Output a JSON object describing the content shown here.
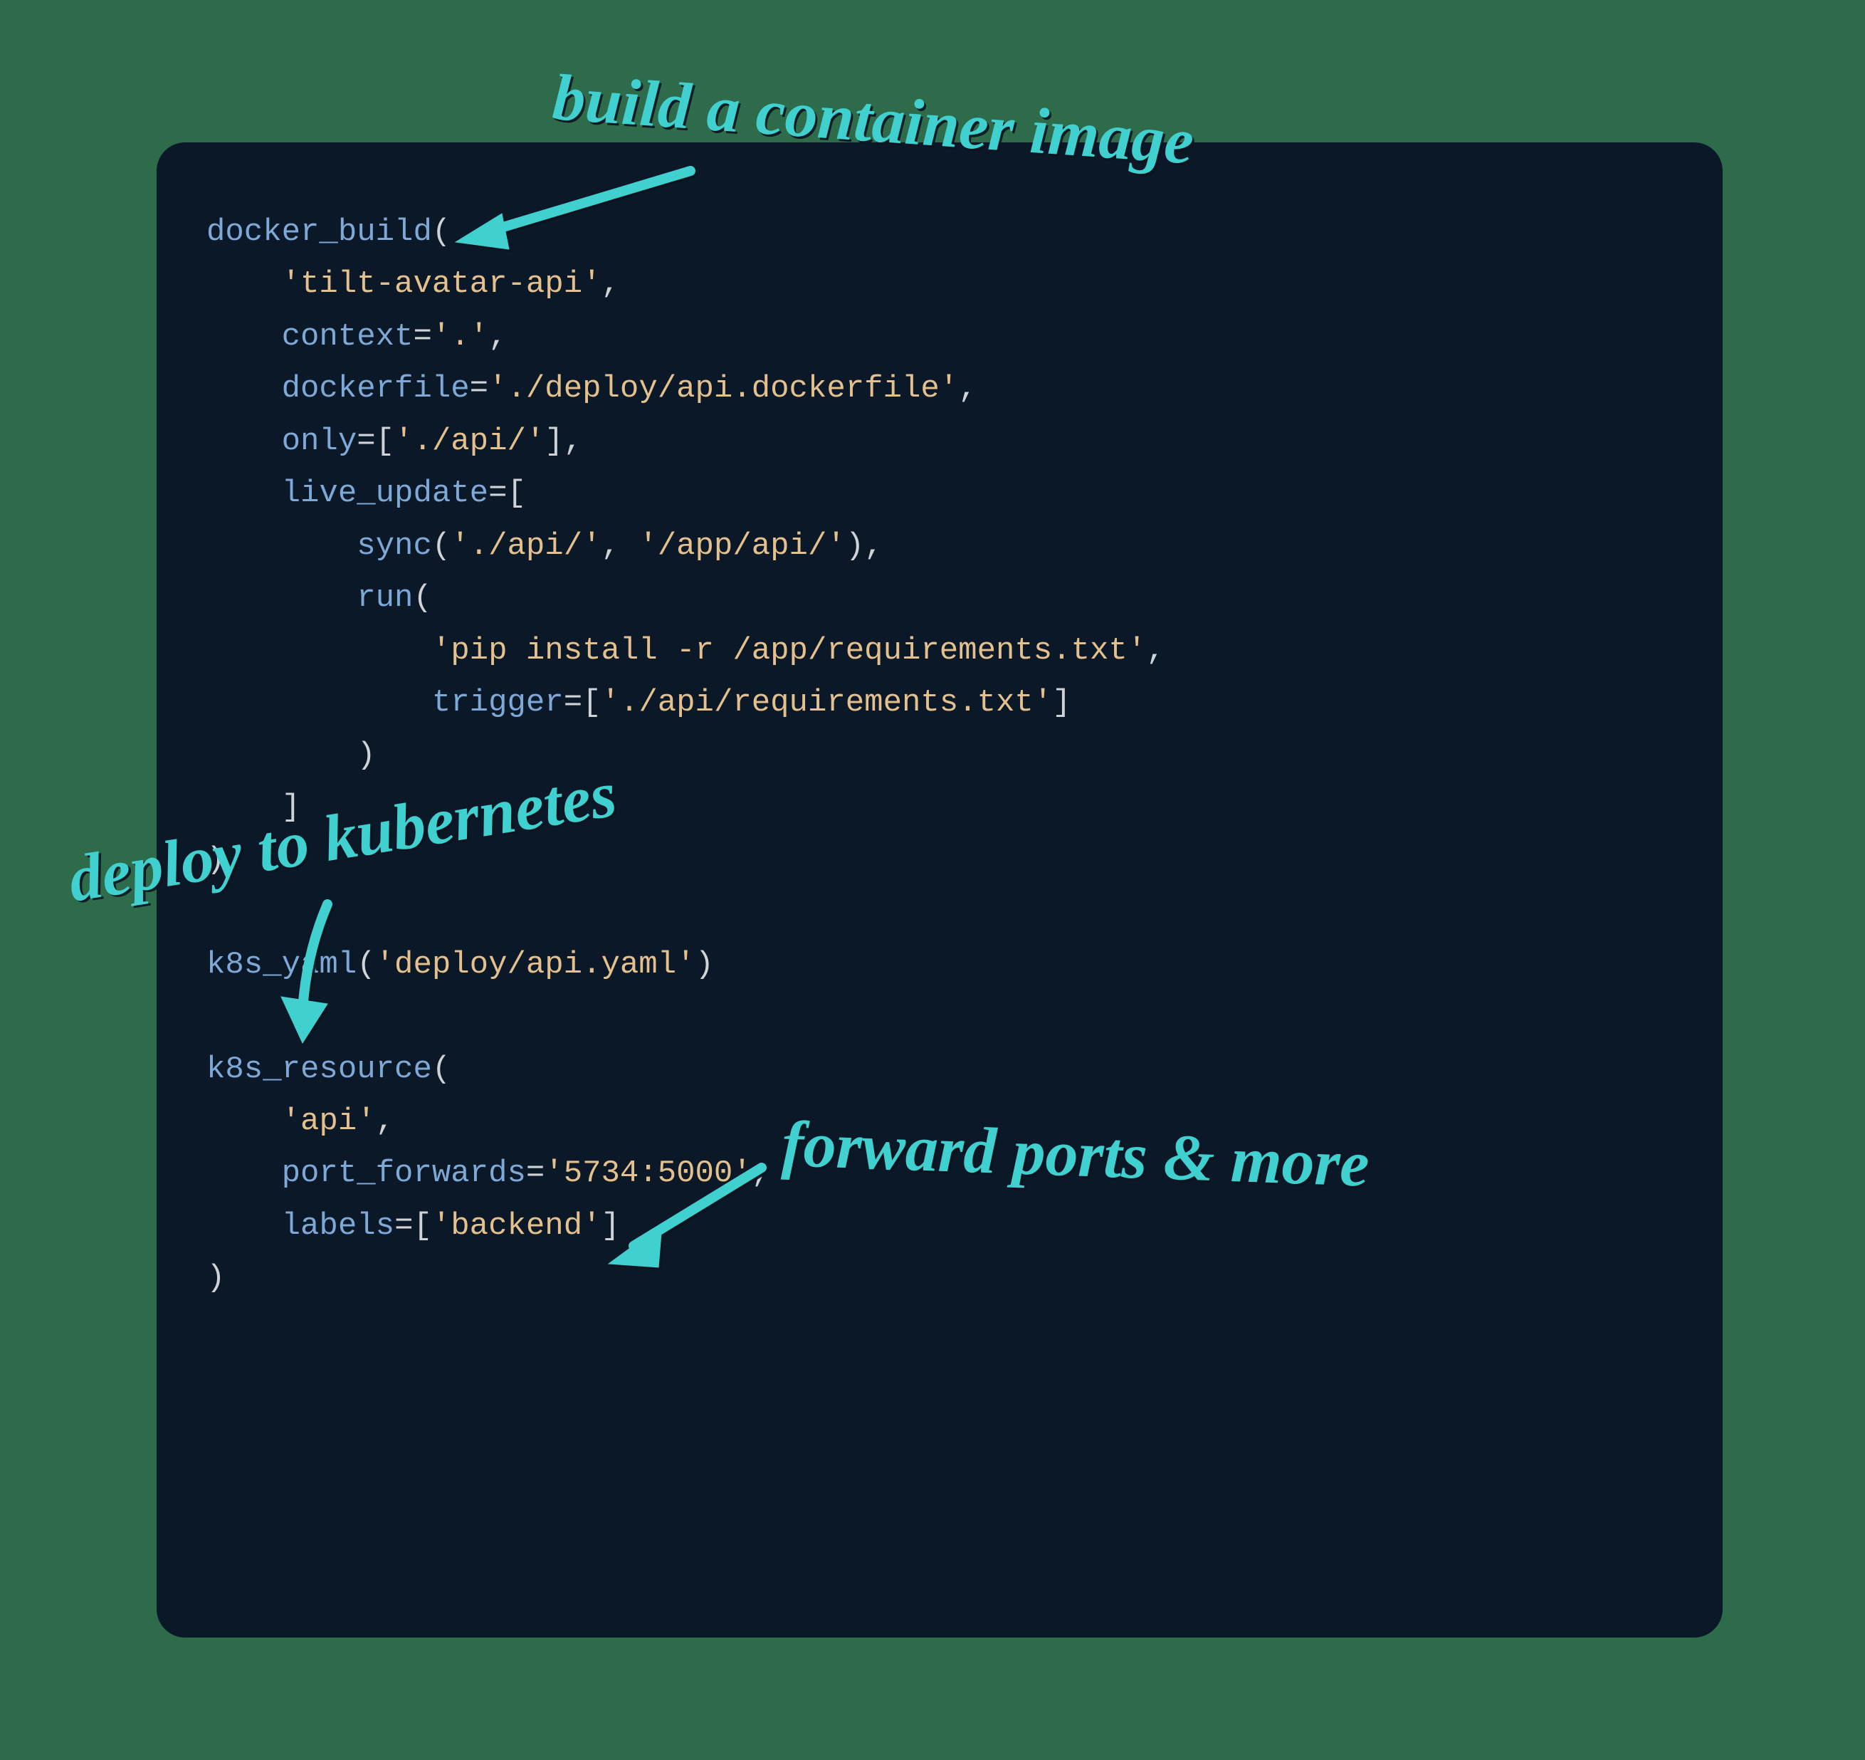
{
  "annotations": {
    "build": "build a container image",
    "deploy": "deploy to kubernetes",
    "forward": "forward ports & more"
  },
  "code": {
    "lines": [
      [
        {
          "cls": "fn",
          "t": "docker_build"
        },
        {
          "cls": "pun",
          "t": "("
        }
      ],
      [
        {
          "cls": "pun",
          "t": "    "
        },
        {
          "cls": "str",
          "t": "'tilt-avatar-api'"
        },
        {
          "cls": "pun",
          "t": ","
        }
      ],
      [
        {
          "cls": "pun",
          "t": "    "
        },
        {
          "cls": "kw",
          "t": "context"
        },
        {
          "cls": "pun",
          "t": "="
        },
        {
          "cls": "str",
          "t": "'.'"
        },
        {
          "cls": "pun",
          "t": ","
        }
      ],
      [
        {
          "cls": "pun",
          "t": "    "
        },
        {
          "cls": "kw",
          "t": "dockerfile"
        },
        {
          "cls": "pun",
          "t": "="
        },
        {
          "cls": "str",
          "t": "'./deploy/api.dockerfile'"
        },
        {
          "cls": "pun",
          "t": ","
        }
      ],
      [
        {
          "cls": "pun",
          "t": "    "
        },
        {
          "cls": "kw",
          "t": "only"
        },
        {
          "cls": "pun",
          "t": "=["
        },
        {
          "cls": "str",
          "t": "'./api/'"
        },
        {
          "cls": "pun",
          "t": "],"
        }
      ],
      [
        {
          "cls": "pun",
          "t": "    "
        },
        {
          "cls": "kw",
          "t": "live_update"
        },
        {
          "cls": "pun",
          "t": "=["
        }
      ],
      [
        {
          "cls": "pun",
          "t": "        "
        },
        {
          "cls": "fn",
          "t": "sync"
        },
        {
          "cls": "pun",
          "t": "("
        },
        {
          "cls": "str",
          "t": "'./api/'"
        },
        {
          "cls": "pun",
          "t": ", "
        },
        {
          "cls": "str",
          "t": "'/app/api/'"
        },
        {
          "cls": "pun",
          "t": "),"
        }
      ],
      [
        {
          "cls": "pun",
          "t": "        "
        },
        {
          "cls": "fn",
          "t": "run"
        },
        {
          "cls": "pun",
          "t": "("
        }
      ],
      [
        {
          "cls": "pun",
          "t": "            "
        },
        {
          "cls": "str",
          "t": "'pip install -r /app/requirements.txt'"
        },
        {
          "cls": "pun",
          "t": ","
        }
      ],
      [
        {
          "cls": "pun",
          "t": "            "
        },
        {
          "cls": "kw",
          "t": "trigger"
        },
        {
          "cls": "pun",
          "t": "=["
        },
        {
          "cls": "str",
          "t": "'./api/requirements.txt'"
        },
        {
          "cls": "pun",
          "t": "]"
        }
      ],
      [
        {
          "cls": "pun",
          "t": "        )"
        }
      ],
      [
        {
          "cls": "pun",
          "t": "    ]"
        }
      ],
      [
        {
          "cls": "pun",
          "t": ")"
        }
      ],
      [
        {
          "cls": "pun",
          "t": ""
        }
      ],
      [
        {
          "cls": "fn",
          "t": "k8s_yaml"
        },
        {
          "cls": "pun",
          "t": "("
        },
        {
          "cls": "str",
          "t": "'deploy/api.yaml'"
        },
        {
          "cls": "pun",
          "t": ")"
        }
      ],
      [
        {
          "cls": "pun",
          "t": ""
        }
      ],
      [
        {
          "cls": "fn",
          "t": "k8s_resource"
        },
        {
          "cls": "pun",
          "t": "("
        }
      ],
      [
        {
          "cls": "pun",
          "t": "    "
        },
        {
          "cls": "str",
          "t": "'api'"
        },
        {
          "cls": "pun",
          "t": ","
        }
      ],
      [
        {
          "cls": "pun",
          "t": "    "
        },
        {
          "cls": "kw",
          "t": "port_forwards"
        },
        {
          "cls": "pun",
          "t": "="
        },
        {
          "cls": "str",
          "t": "'5734:5000'"
        },
        {
          "cls": "pun",
          "t": ","
        }
      ],
      [
        {
          "cls": "pun",
          "t": "    "
        },
        {
          "cls": "kw",
          "t": "labels"
        },
        {
          "cls": "pun",
          "t": "=["
        },
        {
          "cls": "str",
          "t": "'backend'"
        },
        {
          "cls": "pun",
          "t": "]"
        }
      ],
      [
        {
          "cls": "pun",
          "t": ")"
        }
      ]
    ]
  }
}
